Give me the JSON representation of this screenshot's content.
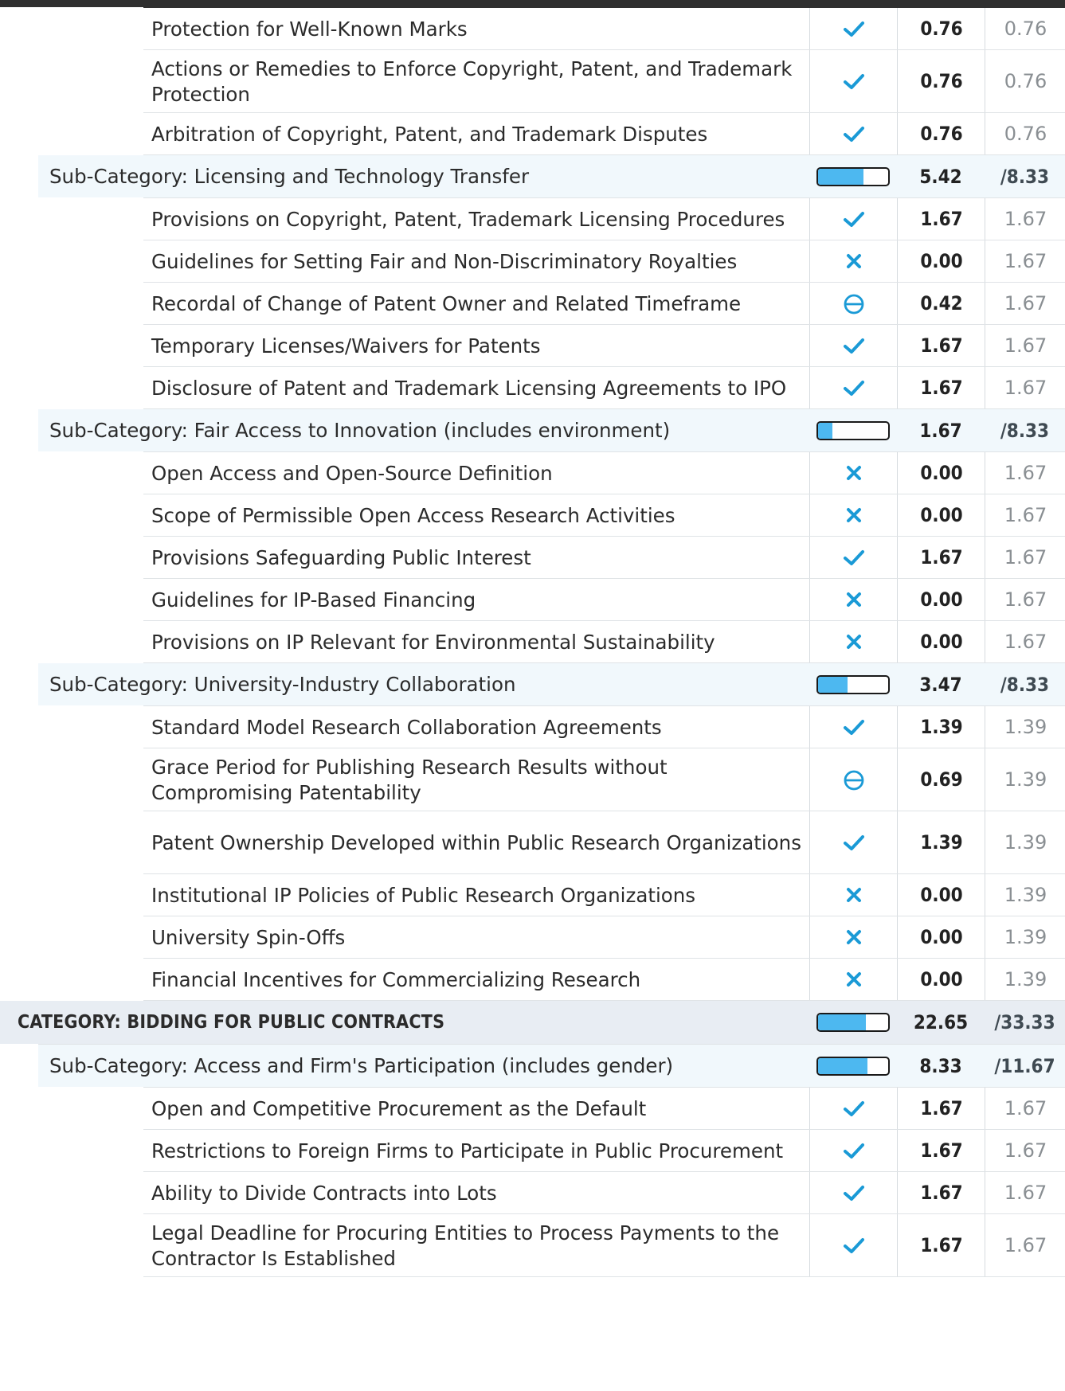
{
  "colors": {
    "accent": "#1a9ad6",
    "bar_fill": "#4db8f0",
    "category_bg": "#e8edf3",
    "subcategory_bg": "#f1f8fc"
  },
  "rows": [
    {
      "type": "item",
      "label": "Protection for Well-Known Marks",
      "icon": "check-icon",
      "score": "0.76",
      "max": "0.76"
    },
    {
      "type": "item",
      "label": "Actions or Remedies to Enforce Copyright, Patent, and Trademark Protection",
      "icon": "check-icon",
      "score": "0.76",
      "max": "0.76"
    },
    {
      "type": "item",
      "label": "Arbitration of Copyright, Patent, and Trademark Disputes",
      "icon": "check-icon",
      "score": "0.76",
      "max": "0.76"
    },
    {
      "type": "sub",
      "label": "Sub-Category: Licensing and Technology Transfer",
      "progress": 0.65,
      "score": "5.42",
      "max": "/8.33"
    },
    {
      "type": "item",
      "label": "Provisions on Copyright, Patent, Trademark Licensing Procedures",
      "icon": "check-icon",
      "score": "1.67",
      "max": "1.67"
    },
    {
      "type": "item",
      "label": "Guidelines for Setting Fair and Non-Discriminatory Royalties",
      "icon": "cross-icon",
      "score": "0.00",
      "max": "1.67"
    },
    {
      "type": "item",
      "label": "Recordal of Change of Patent Owner and Related Timeframe",
      "icon": "partial-icon",
      "score": "0.42",
      "max": "1.67"
    },
    {
      "type": "item",
      "label": "Temporary Licenses/Waivers for Patents",
      "icon": "check-icon",
      "score": "1.67",
      "max": "1.67"
    },
    {
      "type": "item",
      "label": "Disclosure of Patent and Trademark Licensing Agreements to IPO",
      "icon": "check-icon",
      "score": "1.67",
      "max": "1.67"
    },
    {
      "type": "sub",
      "label": "Sub-Category: Fair Access to Innovation (includes environment)",
      "progress": 0.2,
      "score": "1.67",
      "max": "/8.33"
    },
    {
      "type": "item",
      "label": "Open Access and Open-Source Definition",
      "icon": "cross-icon",
      "score": "0.00",
      "max": "1.67"
    },
    {
      "type": "item",
      "label": "Scope of Permissible Open Access Research Activities",
      "icon": "cross-icon",
      "score": "0.00",
      "max": "1.67"
    },
    {
      "type": "item",
      "label": "Provisions Safeguarding Public Interest",
      "icon": "check-icon",
      "score": "1.67",
      "max": "1.67"
    },
    {
      "type": "item",
      "label": "Guidelines for IP-Based Financing",
      "icon": "cross-icon",
      "score": "0.00",
      "max": "1.67"
    },
    {
      "type": "item",
      "label": "Provisions on IP Relevant for Environmental Sustainability",
      "icon": "cross-icon",
      "score": "0.00",
      "max": "1.67"
    },
    {
      "type": "sub",
      "label": "Sub-Category: University-Industry Collaboration",
      "progress": 0.42,
      "score": "3.47",
      "max": "/8.33"
    },
    {
      "type": "item",
      "label": "Standard Model Research Collaboration Agreements",
      "icon": "check-icon",
      "score": "1.39",
      "max": "1.39"
    },
    {
      "type": "item",
      "label": "Grace Period for Publishing Research Results without Compromising Patentability",
      "icon": "partial-icon",
      "score": "0.69",
      "max": "1.39"
    },
    {
      "type": "item",
      "label": "Patent Ownership Developed within Public Research Organizations",
      "icon": "check-icon",
      "score": "1.39",
      "max": "1.39"
    },
    {
      "type": "item",
      "label": "Institutional IP Policies of Public Research Organizations",
      "icon": "cross-icon",
      "score": "0.00",
      "max": "1.39"
    },
    {
      "type": "item",
      "label": "University Spin-Offs",
      "icon": "cross-icon",
      "score": "0.00",
      "max": "1.39"
    },
    {
      "type": "item",
      "label": "Financial Incentives for Commercializing Research",
      "icon": "cross-icon",
      "score": "0.00",
      "max": "1.39"
    },
    {
      "type": "cat",
      "label": "CATEGORY: BIDDING FOR PUBLIC CONTRACTS",
      "progress": 0.68,
      "score": "22.65",
      "max": "/33.33"
    },
    {
      "type": "sub",
      "label": "Sub-Category: Access and Firm's Participation (includes gender)",
      "progress": 0.71,
      "score": "8.33",
      "max": "/11.67"
    },
    {
      "type": "item",
      "label": "Open and Competitive Procurement as the Default",
      "icon": "check-icon",
      "score": "1.67",
      "max": "1.67"
    },
    {
      "type": "item",
      "label": "Restrictions to Foreign Firms to Participate in Public Procurement",
      "icon": "check-icon",
      "score": "1.67",
      "max": "1.67"
    },
    {
      "type": "item",
      "label": "Ability to Divide Contracts into Lots",
      "icon": "check-icon",
      "score": "1.67",
      "max": "1.67"
    },
    {
      "type": "item",
      "label": "Legal Deadline for Procuring Entities to Process Payments to the Contractor Is Established",
      "icon": "check-icon",
      "score": "1.67",
      "max": "1.67"
    }
  ]
}
